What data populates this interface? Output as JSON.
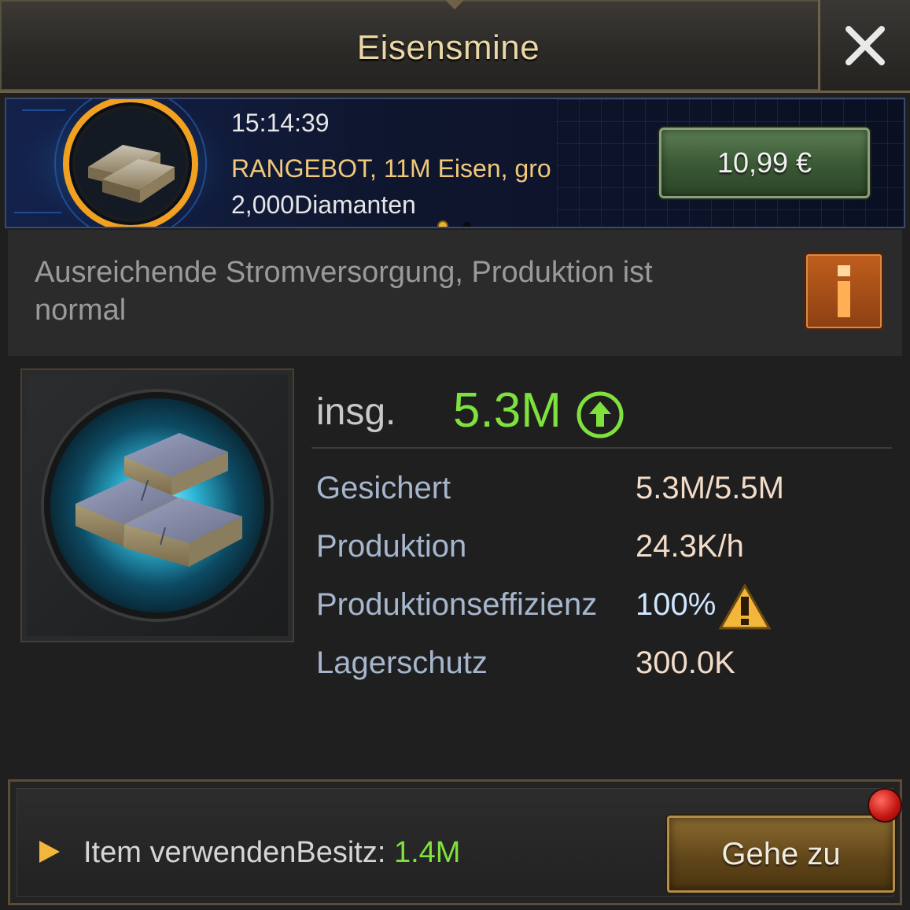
{
  "header": {
    "title": "Eisensmine",
    "close_icon": "close-icon"
  },
  "banner": {
    "time": "15:14:39",
    "offer": "RANGEBOT, 11M Eisen, gro",
    "diamonds": "2,000Diamanten",
    "price": "10,99 €",
    "pager": {
      "count": 2,
      "active": 0
    }
  },
  "status": {
    "text": "Ausreichende Stromversorgung, Produktion ist normal",
    "info_icon": "info-icon"
  },
  "resource": {
    "icon": "iron-ingot-icon",
    "total_label": "insg.",
    "total_value": "5.3M",
    "stats": [
      {
        "label": "Gesichert",
        "value": "5.3M/5.5M"
      },
      {
        "label": "Produktion",
        "value": "24.3K/h"
      },
      {
        "label": "Produktionseffizienz",
        "value": "100%"
      },
      {
        "label": "Lagerschutz",
        "value": "300.0K"
      }
    ]
  },
  "bottom": {
    "item_label": "Item verwendenBesitz: ",
    "item_value": "1.4M",
    "goto_label": "Gehe zu"
  },
  "colors": {
    "accent_green": "#7fe23c",
    "gold": "#ead7a6",
    "offer_gold": "#f0c979"
  }
}
